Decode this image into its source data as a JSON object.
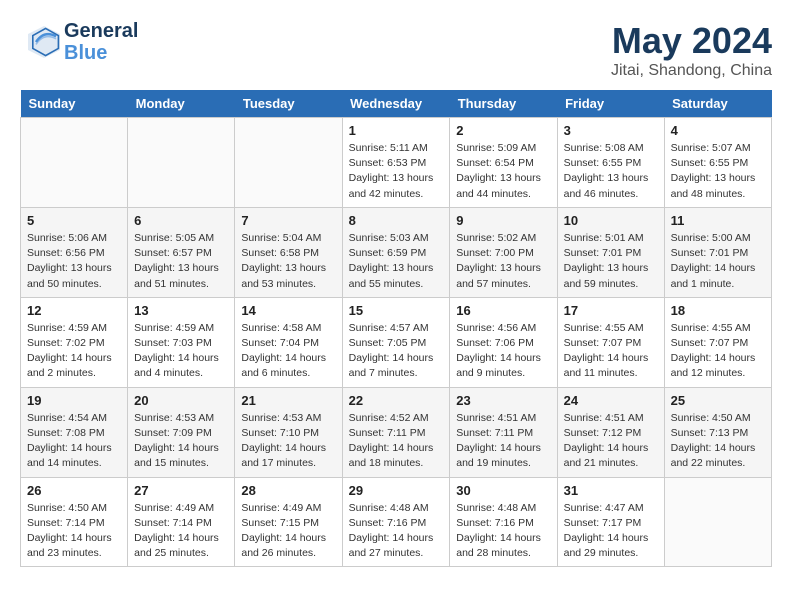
{
  "header": {
    "logo_line1": "General",
    "logo_line2": "Blue",
    "month_title": "May 2024",
    "location": "Jitai, Shandong, China"
  },
  "days_of_week": [
    "Sunday",
    "Monday",
    "Tuesday",
    "Wednesday",
    "Thursday",
    "Friday",
    "Saturday"
  ],
  "weeks": [
    [
      {
        "day": "",
        "sunrise": "",
        "sunset": "",
        "daylight": ""
      },
      {
        "day": "",
        "sunrise": "",
        "sunset": "",
        "daylight": ""
      },
      {
        "day": "",
        "sunrise": "",
        "sunset": "",
        "daylight": ""
      },
      {
        "day": "1",
        "sunrise": "Sunrise: 5:11 AM",
        "sunset": "Sunset: 6:53 PM",
        "daylight": "Daylight: 13 hours and 42 minutes."
      },
      {
        "day": "2",
        "sunrise": "Sunrise: 5:09 AM",
        "sunset": "Sunset: 6:54 PM",
        "daylight": "Daylight: 13 hours and 44 minutes."
      },
      {
        "day": "3",
        "sunrise": "Sunrise: 5:08 AM",
        "sunset": "Sunset: 6:55 PM",
        "daylight": "Daylight: 13 hours and 46 minutes."
      },
      {
        "day": "4",
        "sunrise": "Sunrise: 5:07 AM",
        "sunset": "Sunset: 6:55 PM",
        "daylight": "Daylight: 13 hours and 48 minutes."
      }
    ],
    [
      {
        "day": "5",
        "sunrise": "Sunrise: 5:06 AM",
        "sunset": "Sunset: 6:56 PM",
        "daylight": "Daylight: 13 hours and 50 minutes."
      },
      {
        "day": "6",
        "sunrise": "Sunrise: 5:05 AM",
        "sunset": "Sunset: 6:57 PM",
        "daylight": "Daylight: 13 hours and 51 minutes."
      },
      {
        "day": "7",
        "sunrise": "Sunrise: 5:04 AM",
        "sunset": "Sunset: 6:58 PM",
        "daylight": "Daylight: 13 hours and 53 minutes."
      },
      {
        "day": "8",
        "sunrise": "Sunrise: 5:03 AM",
        "sunset": "Sunset: 6:59 PM",
        "daylight": "Daylight: 13 hours and 55 minutes."
      },
      {
        "day": "9",
        "sunrise": "Sunrise: 5:02 AM",
        "sunset": "Sunset: 7:00 PM",
        "daylight": "Daylight: 13 hours and 57 minutes."
      },
      {
        "day": "10",
        "sunrise": "Sunrise: 5:01 AM",
        "sunset": "Sunset: 7:01 PM",
        "daylight": "Daylight: 13 hours and 59 minutes."
      },
      {
        "day": "11",
        "sunrise": "Sunrise: 5:00 AM",
        "sunset": "Sunset: 7:01 PM",
        "daylight": "Daylight: 14 hours and 1 minute."
      }
    ],
    [
      {
        "day": "12",
        "sunrise": "Sunrise: 4:59 AM",
        "sunset": "Sunset: 7:02 PM",
        "daylight": "Daylight: 14 hours and 2 minutes."
      },
      {
        "day": "13",
        "sunrise": "Sunrise: 4:59 AM",
        "sunset": "Sunset: 7:03 PM",
        "daylight": "Daylight: 14 hours and 4 minutes."
      },
      {
        "day": "14",
        "sunrise": "Sunrise: 4:58 AM",
        "sunset": "Sunset: 7:04 PM",
        "daylight": "Daylight: 14 hours and 6 minutes."
      },
      {
        "day": "15",
        "sunrise": "Sunrise: 4:57 AM",
        "sunset": "Sunset: 7:05 PM",
        "daylight": "Daylight: 14 hours and 7 minutes."
      },
      {
        "day": "16",
        "sunrise": "Sunrise: 4:56 AM",
        "sunset": "Sunset: 7:06 PM",
        "daylight": "Daylight: 14 hours and 9 minutes."
      },
      {
        "day": "17",
        "sunrise": "Sunrise: 4:55 AM",
        "sunset": "Sunset: 7:07 PM",
        "daylight": "Daylight: 14 hours and 11 minutes."
      },
      {
        "day": "18",
        "sunrise": "Sunrise: 4:55 AM",
        "sunset": "Sunset: 7:07 PM",
        "daylight": "Daylight: 14 hours and 12 minutes."
      }
    ],
    [
      {
        "day": "19",
        "sunrise": "Sunrise: 4:54 AM",
        "sunset": "Sunset: 7:08 PM",
        "daylight": "Daylight: 14 hours and 14 minutes."
      },
      {
        "day": "20",
        "sunrise": "Sunrise: 4:53 AM",
        "sunset": "Sunset: 7:09 PM",
        "daylight": "Daylight: 14 hours and 15 minutes."
      },
      {
        "day": "21",
        "sunrise": "Sunrise: 4:53 AM",
        "sunset": "Sunset: 7:10 PM",
        "daylight": "Daylight: 14 hours and 17 minutes."
      },
      {
        "day": "22",
        "sunrise": "Sunrise: 4:52 AM",
        "sunset": "Sunset: 7:11 PM",
        "daylight": "Daylight: 14 hours and 18 minutes."
      },
      {
        "day": "23",
        "sunrise": "Sunrise: 4:51 AM",
        "sunset": "Sunset: 7:11 PM",
        "daylight": "Daylight: 14 hours and 19 minutes."
      },
      {
        "day": "24",
        "sunrise": "Sunrise: 4:51 AM",
        "sunset": "Sunset: 7:12 PM",
        "daylight": "Daylight: 14 hours and 21 minutes."
      },
      {
        "day": "25",
        "sunrise": "Sunrise: 4:50 AM",
        "sunset": "Sunset: 7:13 PM",
        "daylight": "Daylight: 14 hours and 22 minutes."
      }
    ],
    [
      {
        "day": "26",
        "sunrise": "Sunrise: 4:50 AM",
        "sunset": "Sunset: 7:14 PM",
        "daylight": "Daylight: 14 hours and 23 minutes."
      },
      {
        "day": "27",
        "sunrise": "Sunrise: 4:49 AM",
        "sunset": "Sunset: 7:14 PM",
        "daylight": "Daylight: 14 hours and 25 minutes."
      },
      {
        "day": "28",
        "sunrise": "Sunrise: 4:49 AM",
        "sunset": "Sunset: 7:15 PM",
        "daylight": "Daylight: 14 hours and 26 minutes."
      },
      {
        "day": "29",
        "sunrise": "Sunrise: 4:48 AM",
        "sunset": "Sunset: 7:16 PM",
        "daylight": "Daylight: 14 hours and 27 minutes."
      },
      {
        "day": "30",
        "sunrise": "Sunrise: 4:48 AM",
        "sunset": "Sunset: 7:16 PM",
        "daylight": "Daylight: 14 hours and 28 minutes."
      },
      {
        "day": "31",
        "sunrise": "Sunrise: 4:47 AM",
        "sunset": "Sunset: 7:17 PM",
        "daylight": "Daylight: 14 hours and 29 minutes."
      },
      {
        "day": "",
        "sunrise": "",
        "sunset": "",
        "daylight": ""
      }
    ]
  ]
}
